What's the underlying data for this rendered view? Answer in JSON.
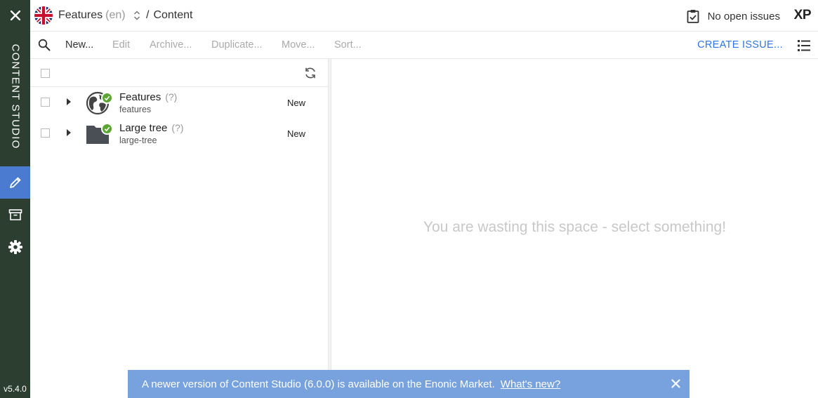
{
  "app": {
    "rail_title": "CONTENT STUDIO",
    "version": "v5.4.0"
  },
  "header": {
    "project_name": "Features",
    "project_lang": "(en)",
    "breadcrumb_separator": "/",
    "breadcrumb_current": "Content",
    "issues_label": "No open issues",
    "product_logo": "XP"
  },
  "toolbar": {
    "new_label": "New...",
    "edit_label": "Edit",
    "archive_label": "Archive...",
    "duplicate_label": "Duplicate...",
    "move_label": "Move...",
    "sort_label": "Sort...",
    "create_issue_label": "CREATE ISSUE..."
  },
  "grid": {
    "rows": [
      {
        "title": "Features",
        "suffix": "(?)",
        "path": "features",
        "status": "New",
        "icon": "site-globe-icon"
      },
      {
        "title": "Large tree",
        "suffix": "(?)",
        "path": "large-tree",
        "status": "New",
        "icon": "folder-icon"
      }
    ]
  },
  "preview": {
    "placeholder": "You are wasting this space - select something!"
  },
  "notification": {
    "text": "A newer version of Content Studio (6.0.0) is available on the Enonic Market.",
    "link": "What's new?"
  },
  "colors": {
    "rail_bg": "#2c3e30",
    "rail_active": "#4a7bd1",
    "accent_link": "#2c76e5",
    "published_badge": "#5ba532",
    "notice_bg": "#77a2dd"
  }
}
